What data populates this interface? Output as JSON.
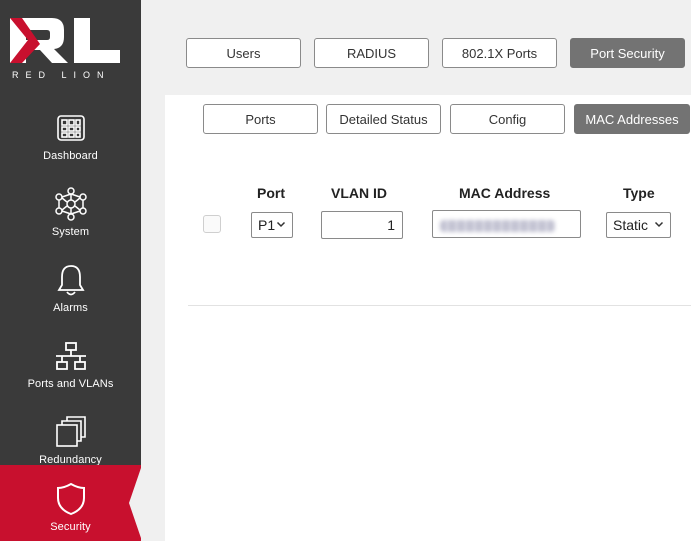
{
  "brand": {
    "logo_letters": "RL",
    "logo_name": "RED LION"
  },
  "sidebar": {
    "items": [
      {
        "label": "Dashboard",
        "icon": "dashboard-icon"
      },
      {
        "label": "System",
        "icon": "network-node-icon"
      },
      {
        "label": "Alarms",
        "icon": "bell-icon"
      },
      {
        "label": "Ports and VLANs",
        "icon": "network-tree-icon"
      },
      {
        "label": "Redundancy",
        "icon": "stacked-windows-icon"
      },
      {
        "label": "Security",
        "icon": "shield-icon",
        "active": true
      }
    ]
  },
  "top_tabs": [
    {
      "label": "Users"
    },
    {
      "label": "RADIUS"
    },
    {
      "label": "802.1X Ports"
    },
    {
      "label": "Port Security",
      "active": true
    }
  ],
  "sub_tabs": [
    {
      "label": "Ports"
    },
    {
      "label": "Detailed Status"
    },
    {
      "label": "Config"
    },
    {
      "label": "MAC Addresses",
      "active": true
    }
  ],
  "table": {
    "columns": [
      "Port",
      "VLAN ID",
      "MAC Address",
      "Type"
    ],
    "rows": [
      {
        "checked": false,
        "port": "P1",
        "vlan_id": "1",
        "mac_address": "",
        "type": "Static"
      }
    ]
  },
  "colors": {
    "accent": "#c8102e",
    "sidebar_bg": "#3a3a3a",
    "active_tab": "#737373"
  }
}
